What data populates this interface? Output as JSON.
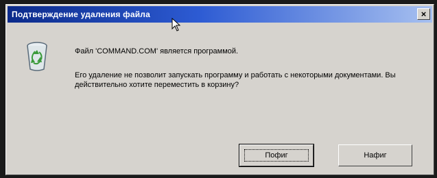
{
  "window": {
    "title": "Подтверждение удаления файла",
    "close_glyph": "×"
  },
  "message": {
    "line1": "Файл 'COMMAND.COM' является программой.",
    "line2": "Его удаление не позволит запускать программу и работать с некоторыми документами. Вы действительно хотите переместить в корзину?"
  },
  "buttons": {
    "yes_label": "Пофиг",
    "no_label": "Нафиг"
  },
  "icons": {
    "dialog_icon": "recycle-bin-icon",
    "cursor": "mouse-cursor-icon"
  },
  "colors": {
    "title_start": "#0b2a8a",
    "title_end": "#a7c0f0",
    "dialog_bg": "#d6d3ce"
  }
}
